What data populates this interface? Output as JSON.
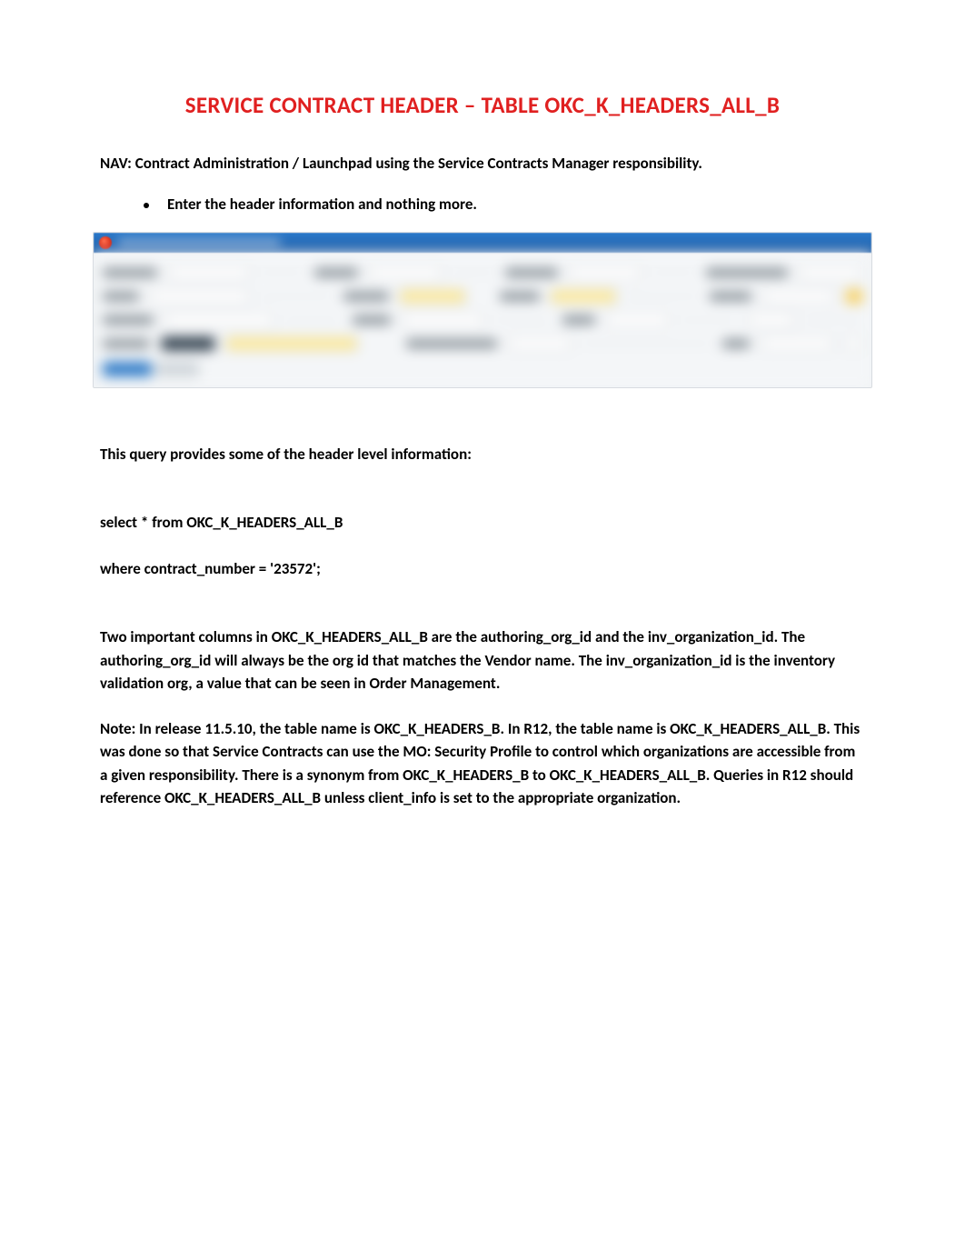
{
  "title": "SERVICE CONTRACT HEADER – TABLE OKC_K_HEADERS_ALL_B",
  "nav_line": "NAV: Contract Administration / Launchpad using the Service Contracts Manager responsibility.",
  "bullet": "Enter the header information and nothing more.",
  "para_intro": "This query provides some of the header level information:",
  "query_line1": "select * from OKC_K_HEADERS_ALL_B",
  "query_line2": "where contract_number = '23572';",
  "para_columns": "Two important columns in OKC_K_HEADERS_ALL_B are the authoring_org_id and the inv_organization_id. The authoring_org_id will always be the org id that matches the Vendor name. The inv_organization_id is the inventory validation org, a value that can be seen in Order Management.",
  "para_note": "Note:  In release 11.5.10, the table name is OKC_K_HEADERS_B.  In R12, the table name is OKC_K_HEADERS_ALL_B.  This was done so that Service Contracts can use the MO: Security Profile to control which organizations are accessible from a given responsibility.  There is a synonym from OKC_K_HEADERS_B to OKC_K_HEADERS_ALL_B.  Queries in R12 should reference OKC_K_HEADERS_ALL_B unless client_info is set to the appropriate organization."
}
